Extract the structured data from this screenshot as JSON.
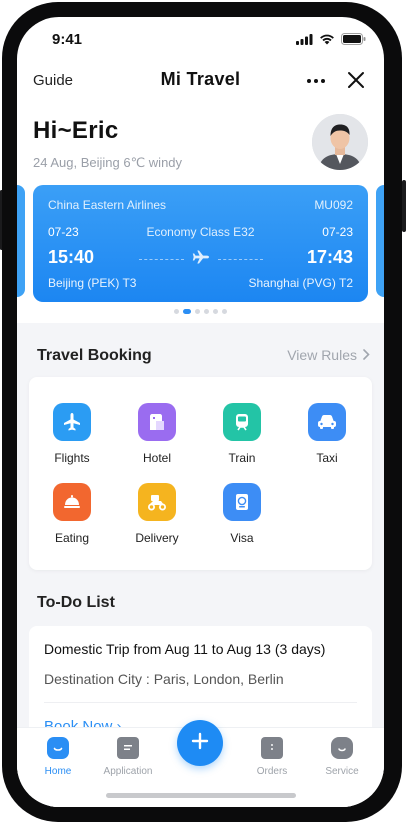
{
  "status_bar": {
    "time": "9:41",
    "icons": [
      "signal-icon",
      "wifi-icon",
      "battery-icon"
    ]
  },
  "nav": {
    "left_label": "Guide",
    "title": "Mi Travel",
    "more_icon": "more-icon",
    "close_icon": "close-icon"
  },
  "greeting": {
    "hello": "Hi~Eric",
    "subtitle": "24 Aug,  Beijing 6℃ windy"
  },
  "flight": {
    "airline": "China Eastern Airlines",
    "flight_no": "MU092",
    "depart_date": "07-23",
    "arrive_date": "07-23",
    "cabin": "Economy Class E32",
    "depart_time": "15:40",
    "arrive_time": "17:43",
    "from_airport": "Beijing (PEK) T3",
    "to_airport": "Shanghai (PVG) T2",
    "carousel_count": 6,
    "carousel_active": 2
  },
  "booking": {
    "title": "Travel Booking",
    "view_rules": "View Rules",
    "items": [
      {
        "label": "Flights",
        "icon": "plane-icon",
        "color": "#2b9cf3"
      },
      {
        "label": "Hotel",
        "icon": "hotel-icon",
        "color": "#9a6cf0"
      },
      {
        "label": "Train",
        "icon": "train-icon",
        "color": "#23c4a6"
      },
      {
        "label": "Taxi",
        "icon": "taxi-icon",
        "color": "#3d8df5"
      },
      {
        "label": "Eating",
        "icon": "dish-icon",
        "color": "#f2672f"
      },
      {
        "label": "Delivery",
        "icon": "delivery-icon",
        "color": "#f5b41f"
      },
      {
        "label": "Visa",
        "icon": "visa-icon",
        "color": "#3d8df5"
      }
    ]
  },
  "todo": {
    "title": "To-Do List",
    "trip": "Domestic Trip from Aug 11 to Aug 13 (3 days)",
    "destination": "Destination City  : Paris, London, Berlin",
    "book_now": "Book Now"
  },
  "tabbar": {
    "tabs": [
      {
        "label": "Home",
        "icon": "home-icon"
      },
      {
        "label": "Application",
        "icon": "application-icon"
      },
      {
        "label": "Orders",
        "icon": "orders-icon"
      },
      {
        "label": "Service",
        "icon": "service-icon"
      }
    ],
    "active": "Home",
    "fab_icon": "plus-icon"
  },
  "colors": {
    "accent": "#2a8ef4",
    "card_blue": "#1c86f2",
    "background": "#f4f5f8"
  }
}
